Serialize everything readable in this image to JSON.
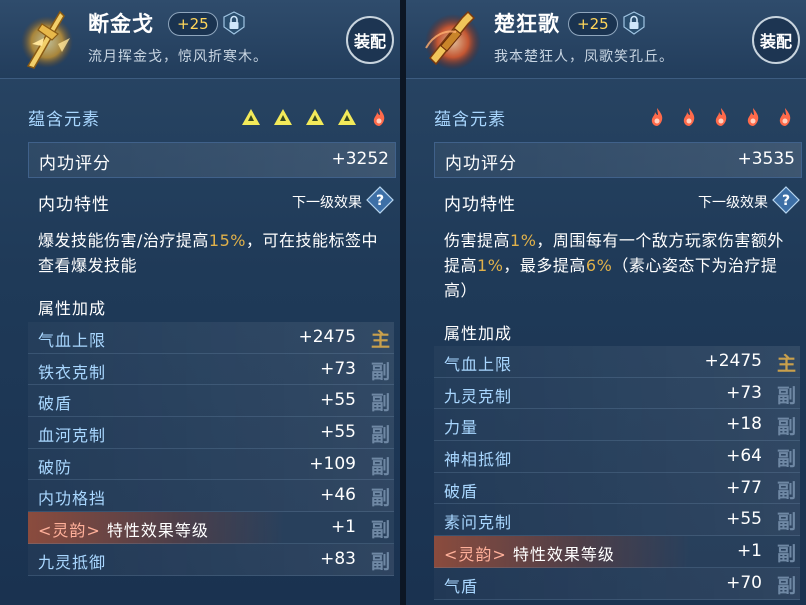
{
  "left": {
    "title": "断金戈",
    "level": "+25",
    "subtitle": "流月挥金戈，惊风折寒木。",
    "equip_label": "装配",
    "elements_label": "蕴含元素",
    "element_icons": [
      "triangle-yellow",
      "triangle-yellow",
      "triangle-yellow",
      "triangle-yellow",
      "flame-red"
    ],
    "score_label": "内功评分",
    "score_value": "+3252",
    "trait_label": "内功特性",
    "next_level_label": "下一级效果",
    "desc_parts": [
      "爆发技能伤害/治疗提高",
      "15%",
      "，可在技能标签中查看爆发技能"
    ],
    "attr_title": "属性加成",
    "attrs": [
      {
        "name": "气血上限",
        "value": "+2475",
        "tag": "主"
      },
      {
        "name": "铁衣克制",
        "value": "+73",
        "tag": "副"
      },
      {
        "name": "破盾",
        "value": "+55",
        "tag": "副"
      },
      {
        "name": "血河克制",
        "value": "+55",
        "tag": "副"
      },
      {
        "name": "破防",
        "value": "+109",
        "tag": "副"
      },
      {
        "name": "内功格挡",
        "value": "+46",
        "tag": "副"
      },
      {
        "name_prefix": "<灵韵>",
        "name": " 特性效果等级",
        "value": "+1",
        "tag": "副"
      },
      {
        "name": "九灵抵御",
        "value": "+83",
        "tag": "副"
      }
    ]
  },
  "right": {
    "title": "楚狂歌",
    "level": "+25",
    "subtitle": "我本楚狂人，凤歌笑孔丘。",
    "equip_label": "装配",
    "elements_label": "蕴含元素",
    "element_icons": [
      "flame-red",
      "flame-red",
      "flame-red",
      "flame-red",
      "flame-red"
    ],
    "score_label": "内功评分",
    "score_value": "+3535",
    "trait_label": "内功特性",
    "next_level_label": "下一级效果",
    "desc_parts": [
      "伤害提高",
      "1%",
      "，周围每有一个敌方玩家伤害额外提高",
      "1%",
      "，最多提高",
      "6%",
      "（素心姿态下为治疗提高）"
    ],
    "attr_title": "属性加成",
    "attrs": [
      {
        "name": "气血上限",
        "value": "+2475",
        "tag": "主"
      },
      {
        "name": "九灵克制",
        "value": "+73",
        "tag": "副"
      },
      {
        "name": "力量",
        "value": "+18",
        "tag": "副"
      },
      {
        "name": "神相抵御",
        "value": "+64",
        "tag": "副"
      },
      {
        "name": "破盾",
        "value": "+77",
        "tag": "副"
      },
      {
        "name": "素问克制",
        "value": "+55",
        "tag": "副"
      },
      {
        "name_prefix": "<灵韵>",
        "name": " 特性效果等级",
        "value": "+1",
        "tag": "副"
      },
      {
        "name": "气盾",
        "value": "+70",
        "tag": "副"
      }
    ]
  },
  "colors": {
    "highlight": "#e0b14a",
    "main_tag": "#c9a04c",
    "sub_tag": "#6f88a4",
    "label_blue": "#a9d7ff"
  }
}
